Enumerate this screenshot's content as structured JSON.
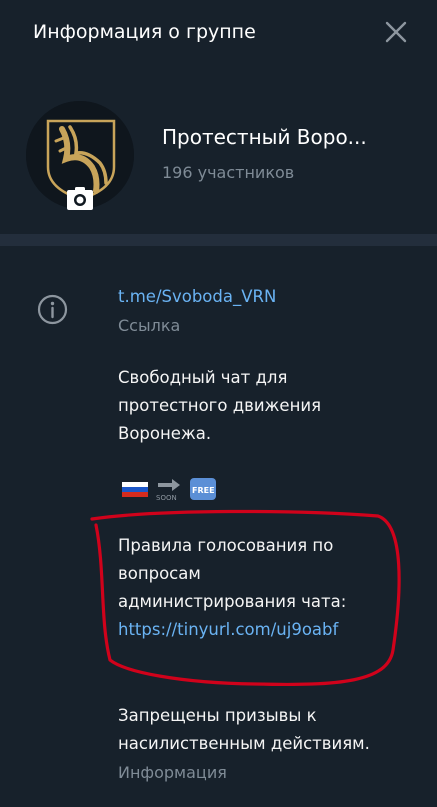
{
  "header": {
    "title": "Информация о группе"
  },
  "group": {
    "name": "Протестный Воро...",
    "members": "196 участников"
  },
  "info": {
    "link": "t.me/Svoboda_VRN",
    "link_caption": "Ссылка",
    "description_line1": "Свободный чат для",
    "description_line2": "протестного движения",
    "description_line3": "Воронежа.",
    "emoji_soon": "SOON",
    "emoji_free": "FREE",
    "rules_line1": "Правила  голосования  по",
    "rules_line2": "вопросам",
    "rules_line3": "администрирования чата:",
    "rules_link": "https://tinyurl.com/uj9oabf",
    "ban_line1": "Запрещены призывы к",
    "ban_line2": "насилиственным действиям.",
    "info_caption": "Информация"
  },
  "colors": {
    "background": "#17212b",
    "divider": "#232e3c",
    "link": "#6ab3f3",
    "muted": "#7f8b96",
    "annotation": "#d0021b"
  },
  "icons": {
    "close": "close-icon",
    "camera": "camera-icon",
    "info": "info-icon",
    "logo": "group-logo",
    "flag": "russia-flag-icon",
    "soon": "soon-arrow-icon",
    "free": "free-icon"
  }
}
